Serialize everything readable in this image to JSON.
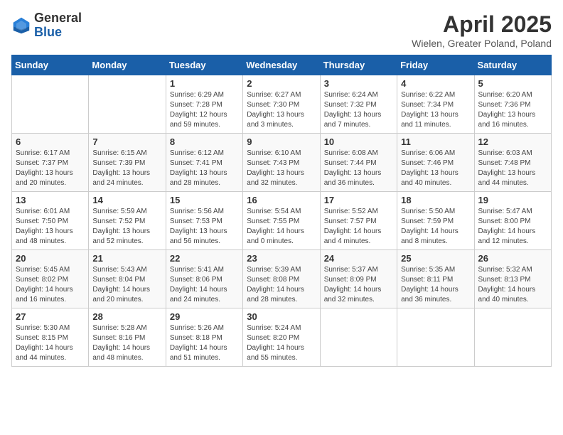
{
  "logo": {
    "general": "General",
    "blue": "Blue"
  },
  "header": {
    "month": "April 2025",
    "location": "Wielen, Greater Poland, Poland"
  },
  "days_of_week": [
    "Sunday",
    "Monday",
    "Tuesday",
    "Wednesday",
    "Thursday",
    "Friday",
    "Saturday"
  ],
  "weeks": [
    [
      {
        "num": "",
        "detail": ""
      },
      {
        "num": "",
        "detail": ""
      },
      {
        "num": "1",
        "detail": "Sunrise: 6:29 AM\nSunset: 7:28 PM\nDaylight: 12 hours and 59 minutes."
      },
      {
        "num": "2",
        "detail": "Sunrise: 6:27 AM\nSunset: 7:30 PM\nDaylight: 13 hours and 3 minutes."
      },
      {
        "num": "3",
        "detail": "Sunrise: 6:24 AM\nSunset: 7:32 PM\nDaylight: 13 hours and 7 minutes."
      },
      {
        "num": "4",
        "detail": "Sunrise: 6:22 AM\nSunset: 7:34 PM\nDaylight: 13 hours and 11 minutes."
      },
      {
        "num": "5",
        "detail": "Sunrise: 6:20 AM\nSunset: 7:36 PM\nDaylight: 13 hours and 16 minutes."
      }
    ],
    [
      {
        "num": "6",
        "detail": "Sunrise: 6:17 AM\nSunset: 7:37 PM\nDaylight: 13 hours and 20 minutes."
      },
      {
        "num": "7",
        "detail": "Sunrise: 6:15 AM\nSunset: 7:39 PM\nDaylight: 13 hours and 24 minutes."
      },
      {
        "num": "8",
        "detail": "Sunrise: 6:12 AM\nSunset: 7:41 PM\nDaylight: 13 hours and 28 minutes."
      },
      {
        "num": "9",
        "detail": "Sunrise: 6:10 AM\nSunset: 7:43 PM\nDaylight: 13 hours and 32 minutes."
      },
      {
        "num": "10",
        "detail": "Sunrise: 6:08 AM\nSunset: 7:44 PM\nDaylight: 13 hours and 36 minutes."
      },
      {
        "num": "11",
        "detail": "Sunrise: 6:06 AM\nSunset: 7:46 PM\nDaylight: 13 hours and 40 minutes."
      },
      {
        "num": "12",
        "detail": "Sunrise: 6:03 AM\nSunset: 7:48 PM\nDaylight: 13 hours and 44 minutes."
      }
    ],
    [
      {
        "num": "13",
        "detail": "Sunrise: 6:01 AM\nSunset: 7:50 PM\nDaylight: 13 hours and 48 minutes."
      },
      {
        "num": "14",
        "detail": "Sunrise: 5:59 AM\nSunset: 7:52 PM\nDaylight: 13 hours and 52 minutes."
      },
      {
        "num": "15",
        "detail": "Sunrise: 5:56 AM\nSunset: 7:53 PM\nDaylight: 13 hours and 56 minutes."
      },
      {
        "num": "16",
        "detail": "Sunrise: 5:54 AM\nSunset: 7:55 PM\nDaylight: 14 hours and 0 minutes."
      },
      {
        "num": "17",
        "detail": "Sunrise: 5:52 AM\nSunset: 7:57 PM\nDaylight: 14 hours and 4 minutes."
      },
      {
        "num": "18",
        "detail": "Sunrise: 5:50 AM\nSunset: 7:59 PM\nDaylight: 14 hours and 8 minutes."
      },
      {
        "num": "19",
        "detail": "Sunrise: 5:47 AM\nSunset: 8:00 PM\nDaylight: 14 hours and 12 minutes."
      }
    ],
    [
      {
        "num": "20",
        "detail": "Sunrise: 5:45 AM\nSunset: 8:02 PM\nDaylight: 14 hours and 16 minutes."
      },
      {
        "num": "21",
        "detail": "Sunrise: 5:43 AM\nSunset: 8:04 PM\nDaylight: 14 hours and 20 minutes."
      },
      {
        "num": "22",
        "detail": "Sunrise: 5:41 AM\nSunset: 8:06 PM\nDaylight: 14 hours and 24 minutes."
      },
      {
        "num": "23",
        "detail": "Sunrise: 5:39 AM\nSunset: 8:08 PM\nDaylight: 14 hours and 28 minutes."
      },
      {
        "num": "24",
        "detail": "Sunrise: 5:37 AM\nSunset: 8:09 PM\nDaylight: 14 hours and 32 minutes."
      },
      {
        "num": "25",
        "detail": "Sunrise: 5:35 AM\nSunset: 8:11 PM\nDaylight: 14 hours and 36 minutes."
      },
      {
        "num": "26",
        "detail": "Sunrise: 5:32 AM\nSunset: 8:13 PM\nDaylight: 14 hours and 40 minutes."
      }
    ],
    [
      {
        "num": "27",
        "detail": "Sunrise: 5:30 AM\nSunset: 8:15 PM\nDaylight: 14 hours and 44 minutes."
      },
      {
        "num": "28",
        "detail": "Sunrise: 5:28 AM\nSunset: 8:16 PM\nDaylight: 14 hours and 48 minutes."
      },
      {
        "num": "29",
        "detail": "Sunrise: 5:26 AM\nSunset: 8:18 PM\nDaylight: 14 hours and 51 minutes."
      },
      {
        "num": "30",
        "detail": "Sunrise: 5:24 AM\nSunset: 8:20 PM\nDaylight: 14 hours and 55 minutes."
      },
      {
        "num": "",
        "detail": ""
      },
      {
        "num": "",
        "detail": ""
      },
      {
        "num": "",
        "detail": ""
      }
    ]
  ]
}
